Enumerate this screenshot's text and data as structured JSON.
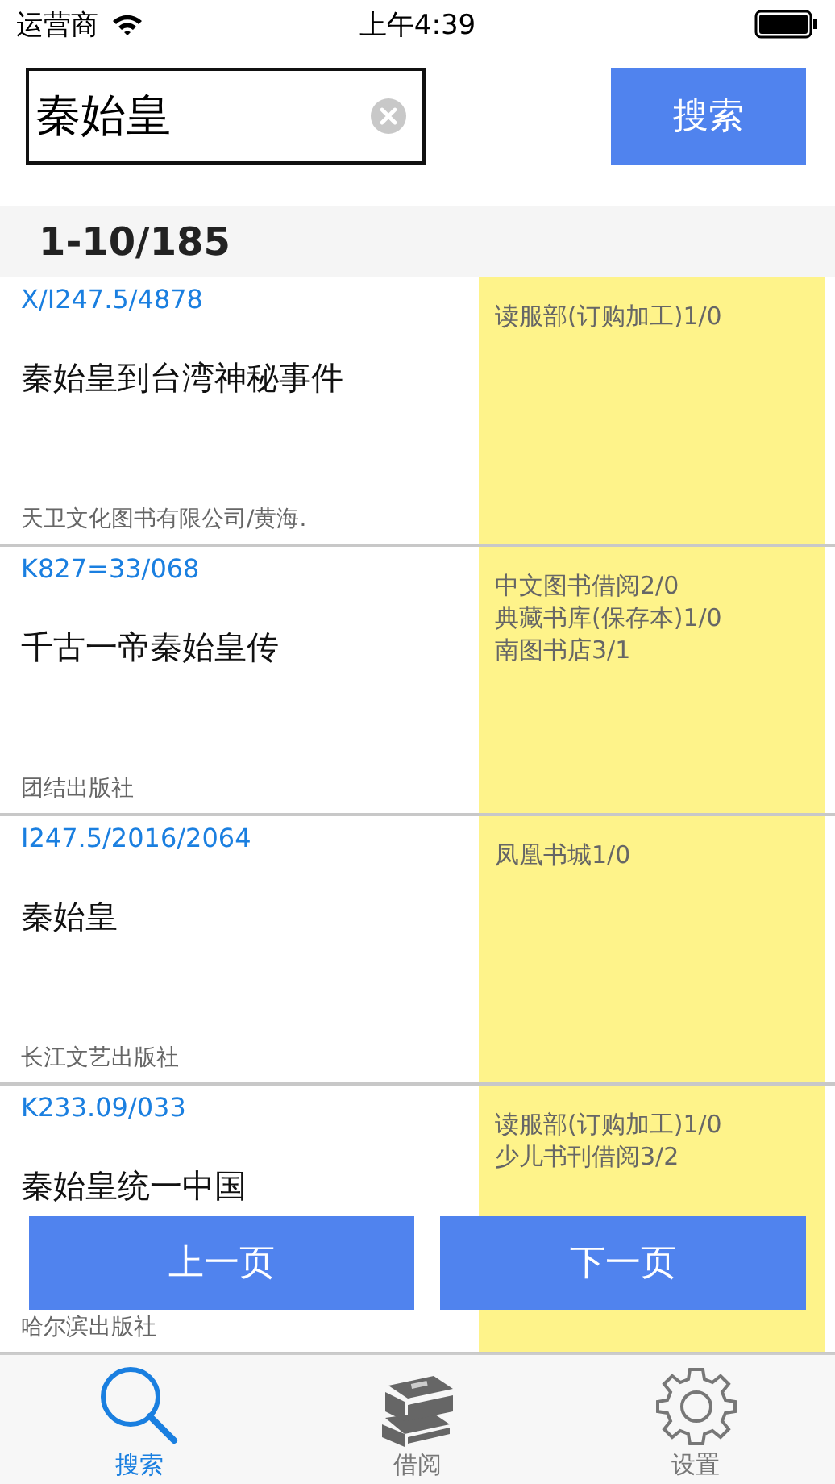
{
  "status_bar": {
    "carrier": "运营商",
    "time": "上午4:39"
  },
  "search": {
    "value": "秦始皇",
    "button": "搜索"
  },
  "result_range": "1-10/185",
  "results": [
    {
      "call_number": "X/I247.5/4878",
      "title": "秦始皇到台湾神秘事件",
      "publisher": "天卫文化图书有限公司/黄海.",
      "holdings": [
        "读服部(订购加工)1/0"
      ]
    },
    {
      "call_number": "K827=33/068",
      "title": "千古一帝秦始皇传",
      "publisher": "团结出版社",
      "holdings": [
        "中文图书借阅2/0",
        "典藏书库(保存本)1/0",
        "南图书店3/1"
      ]
    },
    {
      "call_number": "I247.5/2016/2064",
      "title": "秦始皇",
      "publisher": "长江文艺出版社",
      "holdings": [
        "凤凰书城1/0"
      ]
    },
    {
      "call_number": "K233.09/033",
      "title": "秦始皇统一中国",
      "publisher": "哈尔滨出版社",
      "holdings": [
        "读服部(订购加工)1/0",
        "少儿书刊借阅3/2"
      ]
    }
  ],
  "pager": {
    "previous": "上一页",
    "next": "下一页"
  },
  "tabs": [
    {
      "kind": "search",
      "label": "搜索",
      "selected": true
    },
    {
      "kind": "books",
      "label": "借阅",
      "selected": false
    },
    {
      "kind": "settings",
      "label": "设置",
      "selected": false
    }
  ]
}
